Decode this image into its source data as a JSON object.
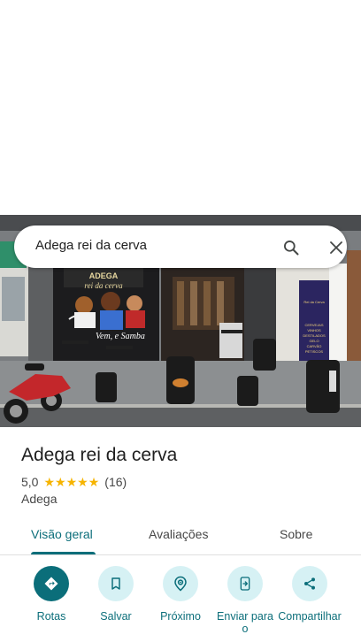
{
  "search": {
    "query": "Adega rei da cerva"
  },
  "photo": {
    "sign_main": "ADEGA",
    "sign_sub": "rei da cerva",
    "mural_text": "Vem, e Samba",
    "banner_title": "Rei da Cerva",
    "banner_lines": [
      "CERVEJAS",
      "VINHOS",
      "DESTILADOS",
      "GELO",
      "CARVÃO",
      "PETISCOS"
    ]
  },
  "place": {
    "name": "Adega rei da cerva",
    "rating": "5,0",
    "review_count": "(16)",
    "category": "Adega"
  },
  "tabs": [
    {
      "label": "Visão geral"
    },
    {
      "label": "Avaliações"
    },
    {
      "label": "Sobre"
    }
  ],
  "actions": [
    {
      "label": "Rotas",
      "icon": "directions-icon"
    },
    {
      "label": "Salvar",
      "icon": "bookmark-icon"
    },
    {
      "label": "Próximo",
      "icon": "nearby-icon"
    },
    {
      "label": "Enviar para o",
      "icon": "send-to-phone-icon"
    },
    {
      "label": "Compartilhar",
      "icon": "share-icon"
    }
  ],
  "colors": {
    "accent": "#0b6e7a",
    "accent_light": "#d6f1f4",
    "star": "#f6b400"
  }
}
